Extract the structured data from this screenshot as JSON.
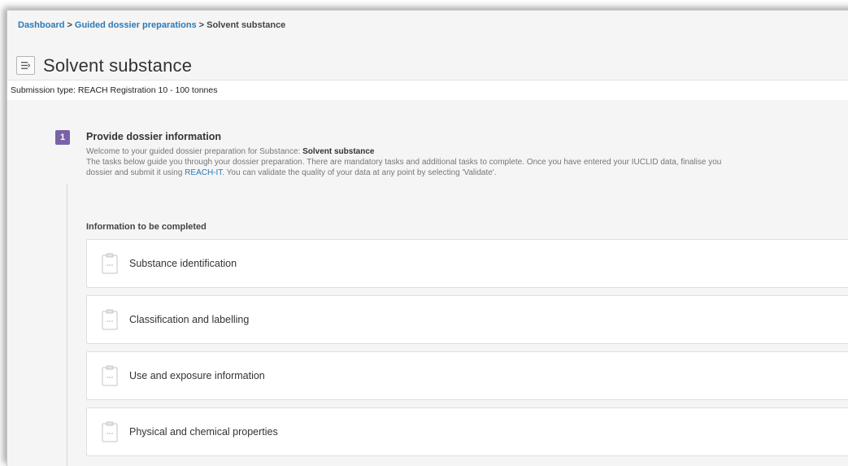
{
  "breadcrumb": {
    "items": [
      "Dashboard",
      "Guided dossier preparations",
      "Solvent substance"
    ],
    "separator": ">"
  },
  "header": {
    "menu_icon": "menu-icon",
    "title": "Solvent substance"
  },
  "submission": {
    "text": "Submission type: REACH Registration 10 - 100 tonnes"
  },
  "step": {
    "number": "1",
    "title": "Provide dossier information",
    "welcome_prefix": "Welcome to your guided dossier preparation for Substance: ",
    "welcome_substance": "Solvent substance",
    "desc_line1": "The tasks below guide you through your dossier preparation. There are mandatory tasks and additional tasks to complete. Once you have entered your IUCLID data, finalise you",
    "desc_line2_prefix": "dossier and submit it using ",
    "desc_link": "REACH-IT",
    "desc_line2_suffix": ". You can validate the quality of your data at any point by selecting 'Validate'."
  },
  "section": {
    "title": "Information to be completed"
  },
  "tasks": [
    {
      "label": "Substance identification",
      "icon": "clipboard-icon"
    },
    {
      "label": "Classification and labelling",
      "icon": "clipboard-icon"
    },
    {
      "label": "Use and exposure information",
      "icon": "clipboard-icon"
    },
    {
      "label": "Physical and chemical properties",
      "icon": "clipboard-icon"
    }
  ],
  "colors": {
    "link": "#2a7ab8",
    "step_badge": "#7a62a8",
    "background": "#f5f5f5"
  }
}
